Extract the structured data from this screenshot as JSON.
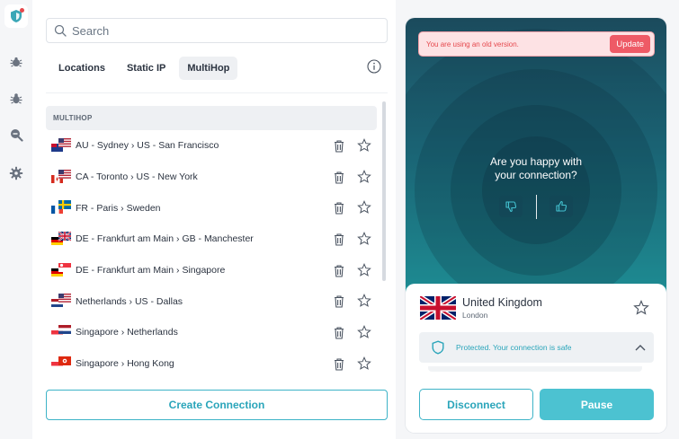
{
  "sidebar": {
    "items": [
      {
        "name": "vpn",
        "icon": "shield-icon",
        "badge": "red-dot"
      },
      {
        "name": "antivirus",
        "icon": "bug-shield-icon"
      },
      {
        "name": "threat-protection",
        "icon": "bug-icon"
      },
      {
        "name": "scan",
        "icon": "search-minus-icon"
      },
      {
        "name": "settings",
        "icon": "gear-icon"
      }
    ]
  },
  "search": {
    "placeholder": "Search",
    "icon": "search-icon"
  },
  "tabs": [
    {
      "label": "Locations",
      "active": false
    },
    {
      "label": "Static IP",
      "active": false
    },
    {
      "label": "MultiHop",
      "active": true
    }
  ],
  "list": {
    "section_title": "MULTIHOP",
    "rows": [
      {
        "label": "AU - Sydney  ›  US - San Francisco",
        "flags": [
          "au",
          "us"
        ]
      },
      {
        "label": "CA - Toronto  ›  US - New York",
        "flags": [
          "ca",
          "us"
        ]
      },
      {
        "label": "FR - Paris  ›  Sweden",
        "flags": [
          "fr",
          "se"
        ]
      },
      {
        "label": "DE - Frankfurt am Main  ›  GB - Manchester",
        "flags": [
          "de",
          "gb"
        ]
      },
      {
        "label": "DE - Frankfurt am Main  ›  Singapore",
        "flags": [
          "de",
          "sg"
        ]
      },
      {
        "label": "Netherlands  ›  US - Dallas",
        "flags": [
          "nl",
          "us"
        ]
      },
      {
        "label": "Singapore  ›  Netherlands",
        "flags": [
          "sg",
          "nl"
        ]
      },
      {
        "label": "Singapore  ›  Hong Kong",
        "flags": [
          "sg",
          "hk"
        ]
      }
    ]
  },
  "create_button": "Create Connection",
  "connection": {
    "alert_text": "You are using an old version.",
    "update_label": "Update",
    "question_line1": "Are you happy with",
    "question_line2": "your connection?",
    "country": "United Kingdom",
    "city": "London",
    "status_text": "Protected. Your connection is safe",
    "disconnect_label": "Disconnect",
    "pause_label": "Pause"
  },
  "colors": {
    "accent": "#3db3c7",
    "alert_red": "#e5484d",
    "hero_top": "#1b4a5c",
    "hero_bottom": "#22a3a8"
  }
}
